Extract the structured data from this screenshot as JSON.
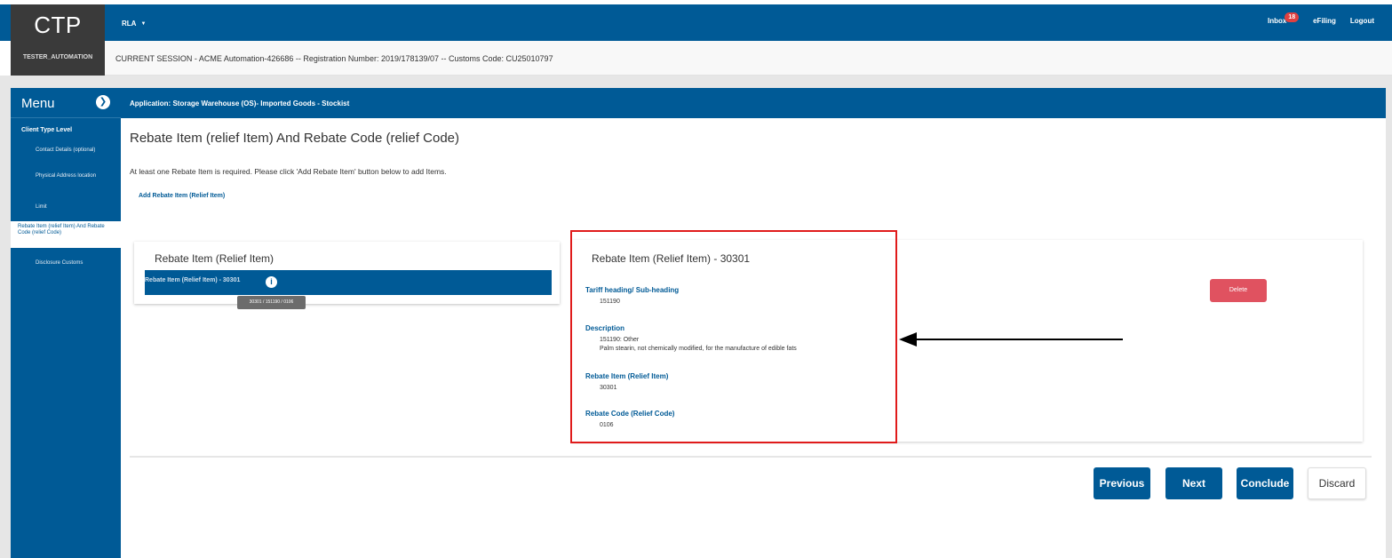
{
  "header": {
    "logo": "CTP",
    "username": "TESTER_AUTOMATION",
    "menu_label": "RLA",
    "inbox_label": "Inbox",
    "inbox_count": "18",
    "efiling_label": "eFiling",
    "logout_label": "Logout"
  },
  "session": {
    "text": "CURRENT SESSION - ACME Automation-426686 -- Registration Number: 2019/178139/07 -- Customs Code: CU25010797"
  },
  "sidebar": {
    "menu_title": "Menu",
    "section_title": "Client Type Level",
    "items": [
      {
        "label": "Contact Details (optional)"
      },
      {
        "label": "Physical Address location"
      },
      {
        "label": "Limit"
      },
      {
        "label": "Rebate Item (relief Item) And Rebate Code (relief Code)",
        "active": true
      },
      {
        "label": "Disclosure Customs"
      }
    ]
  },
  "application": {
    "text": "Application: Storage Warehouse (OS)- Imported Goods - Stockist"
  },
  "main": {
    "title": "Rebate Item (relief Item) And Rebate Code (relief Code)",
    "instruction": "At least one Rebate Item is required. Please click 'Add Rebate Item' button below to add Items.",
    "add_link": "Add Rebate Item (Relief Item)"
  },
  "list_card": {
    "title": "Rebate Item (Relief Item)",
    "row_label": "Rebate Item (Relief Item) - 30301",
    "tooltip": "30301 / 151190 / 0106"
  },
  "detail": {
    "title": "Rebate Item (Relief Item) - 30301",
    "tariff_label": "Tariff heading/ Sub-heading",
    "tariff_value": "151190",
    "description_label": "Description",
    "description_line1": "151190: Other",
    "description_line2": "Palm stearin, not chemically modified, for the manufacture of edible fats",
    "rebate_item_label": "Rebate Item (Relief Item)",
    "rebate_item_value": "30301",
    "rebate_code_label": "Rebate Code (Relief Code)",
    "rebate_code_value": "0106",
    "delete_label": "Delete"
  },
  "footer": {
    "previous_label": "Previous",
    "next_label": "Next",
    "conclude_label": "Conclude",
    "discard_label": "Discard"
  },
  "colors": {
    "primary": "#005a96",
    "delete": "#e05260",
    "highlight": "#e01b1b"
  }
}
